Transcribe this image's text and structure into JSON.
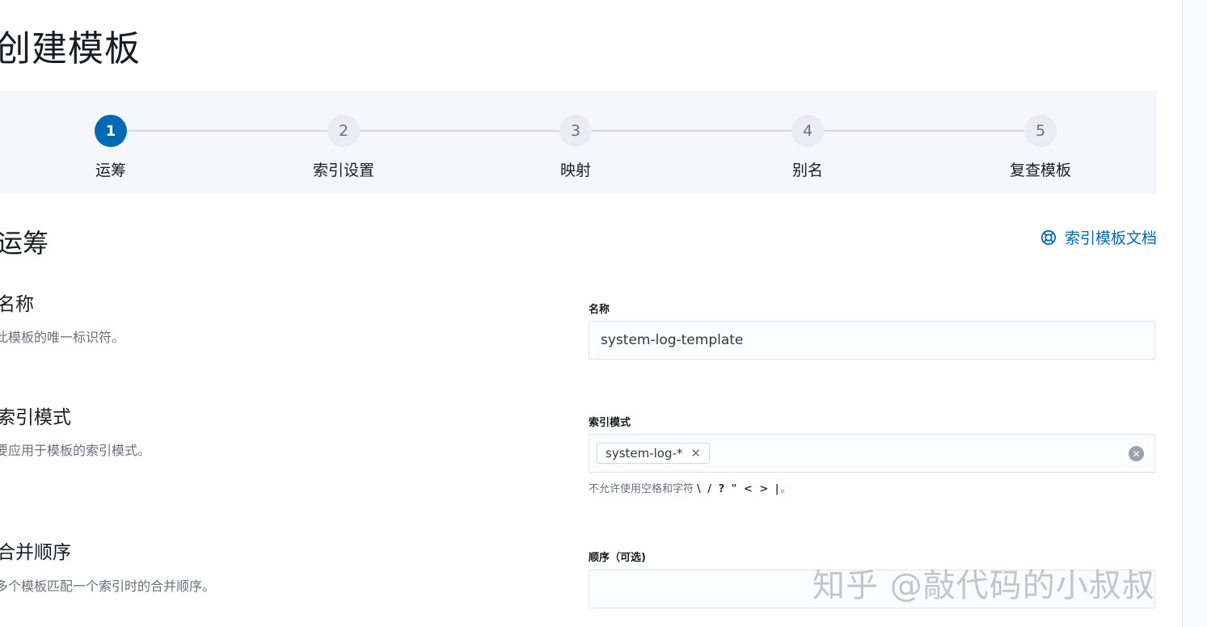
{
  "page_title": "创建模板",
  "steps": [
    {
      "number": "1",
      "title": "运筹",
      "status": "current"
    },
    {
      "number": "2",
      "title": "索引设置",
      "status": "upcoming"
    },
    {
      "number": "3",
      "title": "映射",
      "status": "upcoming"
    },
    {
      "number": "4",
      "title": "别名",
      "status": "upcoming"
    },
    {
      "number": "5",
      "title": "复查模板",
      "status": "upcoming"
    }
  ],
  "section": {
    "title": "运筹",
    "doc_link": {
      "label": "索引模板文档",
      "icon": "help-lifebuoy-icon"
    }
  },
  "fields": {
    "name": {
      "title": "名称",
      "description": "此模板的唯一标识符。",
      "label": "名称",
      "value": "system-log-template"
    },
    "index_patterns": {
      "title": "索引模式",
      "description": "要应用于模板的索引模式。",
      "label": "索引模式",
      "pills": [
        "system-log-*"
      ],
      "help_text": "不允许使用空格和字符",
      "help_chars": "\\ / ? \" < > |",
      "help_suffix": "。"
    },
    "order": {
      "title": "合并顺序",
      "description": "多个模板匹配一个索引时的合并顺序。",
      "label": "顺序（可选)",
      "value": ""
    }
  },
  "watermark": "知乎 @敲代码的小叔叔",
  "colors": {
    "accent": "#006bb4",
    "panel_bg": "#f5f7fa",
    "text_primary": "#1a1c21",
    "text_subdued": "#69707d"
  }
}
